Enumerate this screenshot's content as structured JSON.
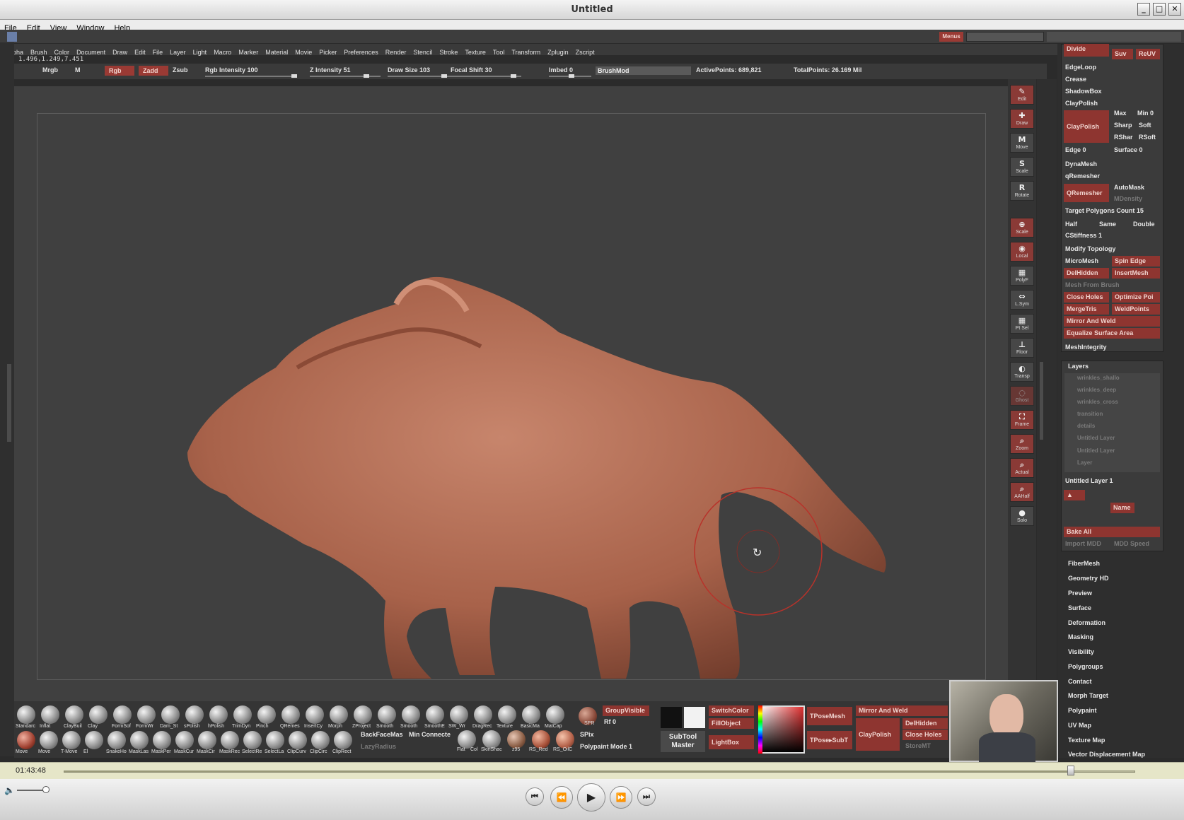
{
  "window": {
    "title": "Untitled"
  },
  "menubar": [
    "File",
    "Edit",
    "View",
    "Window",
    "Help"
  ],
  "zbrush_menu": [
    "Alpha",
    "Brush",
    "Color",
    "Document",
    "Draw",
    "Edit",
    "File",
    "Layer",
    "Light",
    "Macro",
    "Marker",
    "Material",
    "Movie",
    "Picker",
    "Preferences",
    "Render",
    "Stencil",
    "Stroke",
    "Texture",
    "Tool",
    "Transform",
    "Zplugin",
    "Zscript"
  ],
  "menus_button": "Menus",
  "coords": "1.496,1.249,7.451",
  "toolbar": {
    "mrgb": "Mrgb",
    "m": "M",
    "rgb": "Rgb",
    "zadd": "Zadd",
    "zsub": "Zsub",
    "rgb_intensity": "Rgb Intensity 100",
    "z_intensity": "Z Intensity 51",
    "draw_size": "Draw Size 103",
    "focal_shift": "Focal Shift 30",
    "imbed": "Imbed 0",
    "brush_mod": "BrushMod",
    "active_points": "ActivePoints: 689,821",
    "total_points": "TotalPoints: 26.169 Mil"
  },
  "right_shelf": [
    "Edit",
    "Draw",
    "Move",
    "Scale",
    "Rotate",
    "Scale",
    "Local",
    "PolyF",
    "L.Sym",
    "Pt Sel",
    "Floor",
    "Transp",
    "Ghost",
    "Frame",
    "Zoom",
    "Actual",
    "AAHalf",
    "Solo"
  ],
  "right_panel": {
    "divide": "Divide",
    "suv": "Suv",
    "reuv": "ReUV",
    "edgeloop": "EdgeLoop",
    "crease": "Crease",
    "shadowbox": "ShadowBox",
    "claypolish_header": "ClayPolish",
    "claypolish_btn": "ClayPolish",
    "max": "Max",
    "min": "Min 0",
    "sharp": "Sharp",
    "soft": "Soft",
    "rshar": "RShar",
    "rsoft": "RSoft",
    "edge": "Edge 0",
    "surface": "Surface 0",
    "dynamesh": "DynaMesh",
    "qremesher_header": "qRemesher",
    "qremesher_btn": "QRemesher",
    "automask": "AutoMask",
    "mdensity": "MDensity",
    "target_polys": "Target Polygons Count 15",
    "half": "Half",
    "same": "Same",
    "double": "Double",
    "cstiffness": "CStiffness 1",
    "modify_topology": "Modify Topology",
    "micromesh": "MicroMesh",
    "spin_edge": "Spin Edge",
    "delhidden": "DelHidden",
    "insertmesh": "InsertMesh",
    "mesh_from_brush": "Mesh From Brush",
    "close_holes": "Close Holes",
    "optimize_points": "Optimize Poi",
    "mergetris": "MergeTris",
    "weldpoints": "WeldPoints",
    "mirror_and_weld": "Mirror And Weld",
    "equalize": "Equalize Surface Area",
    "meshintegrity": "MeshIntegrity",
    "layers_header": "Layers",
    "layers": [
      "wrinkles_shallo",
      "wrinkles_deep",
      "wrinkles_cross",
      "transition",
      "details",
      "Untitled Layer",
      "Untitled Layer",
      "Layer"
    ],
    "current_layer": "Untitled Layer 1",
    "name": "Name",
    "bake_all": "Bake All",
    "import_mdd": "Import MDD",
    "mdd_speed": "MDD Speed",
    "sections": [
      "FiberMesh",
      "Geometry HD",
      "Preview",
      "Surface",
      "Deformation",
      "Masking",
      "Visibility",
      "Polygroups",
      "Contact",
      "Morph Target",
      "Polypaint",
      "UV Map",
      "Texture Map",
      "Vector Displacement Map"
    ]
  },
  "bottom_shelf": {
    "row1": [
      "Standarc",
      "Inflat",
      "ClayBuil",
      "Clay",
      "FormSof",
      "FormWr",
      "Dam_St",
      "sPolish",
      "hPolish",
      "TrimDyn",
      "Pinch",
      "QRemes",
      "InsertCy",
      "Morph",
      "ZProject",
      "Smooth",
      "Smooth",
      "SmoothE",
      "SW_Wr",
      "DragRec",
      "Texture",
      "BasicMa",
      "MatCap"
    ],
    "row2": [
      "Move",
      "Move",
      "T-Move",
      "El",
      "SnakeHo",
      "MaskLas",
      "MaskPer",
      "MaskCur",
      "MaskCir",
      "MaskRec",
      "SelectRe",
      "SelectLa",
      "ClipCurv",
      "ClipCirc",
      "ClipRect"
    ],
    "backfacemask": "BackFaceMas",
    "min_connected": "Min Connecte",
    "lazyradius": "LazyRadius",
    "materials": [
      "Flat",
      "Col",
      "SkinShac",
      "z95",
      "RS_Red",
      "RS_OilC"
    ],
    "spr": "SPR",
    "groupvisible": "GroupVisible",
    "rf": "Rf 0",
    "spix": "SPix",
    "polypaint_mode": "Polypaint Mode 1",
    "subtool_master": "SubTool Master",
    "switchcolor": "SwitchColor",
    "fillobject": "FillObject",
    "lightbox": "LightBox",
    "tposemesh": "TPoseMesh",
    "tpose_subt": "TPose▸SubT",
    "mirror_and_weld": "Mirror And Weld",
    "claypolish": "ClayPolish",
    "delhidden": "DelHidden",
    "close_holes": "Close Holes",
    "storemt": "StoreMT"
  },
  "player": {
    "time": "01:43:48",
    "progress": 0.94
  }
}
